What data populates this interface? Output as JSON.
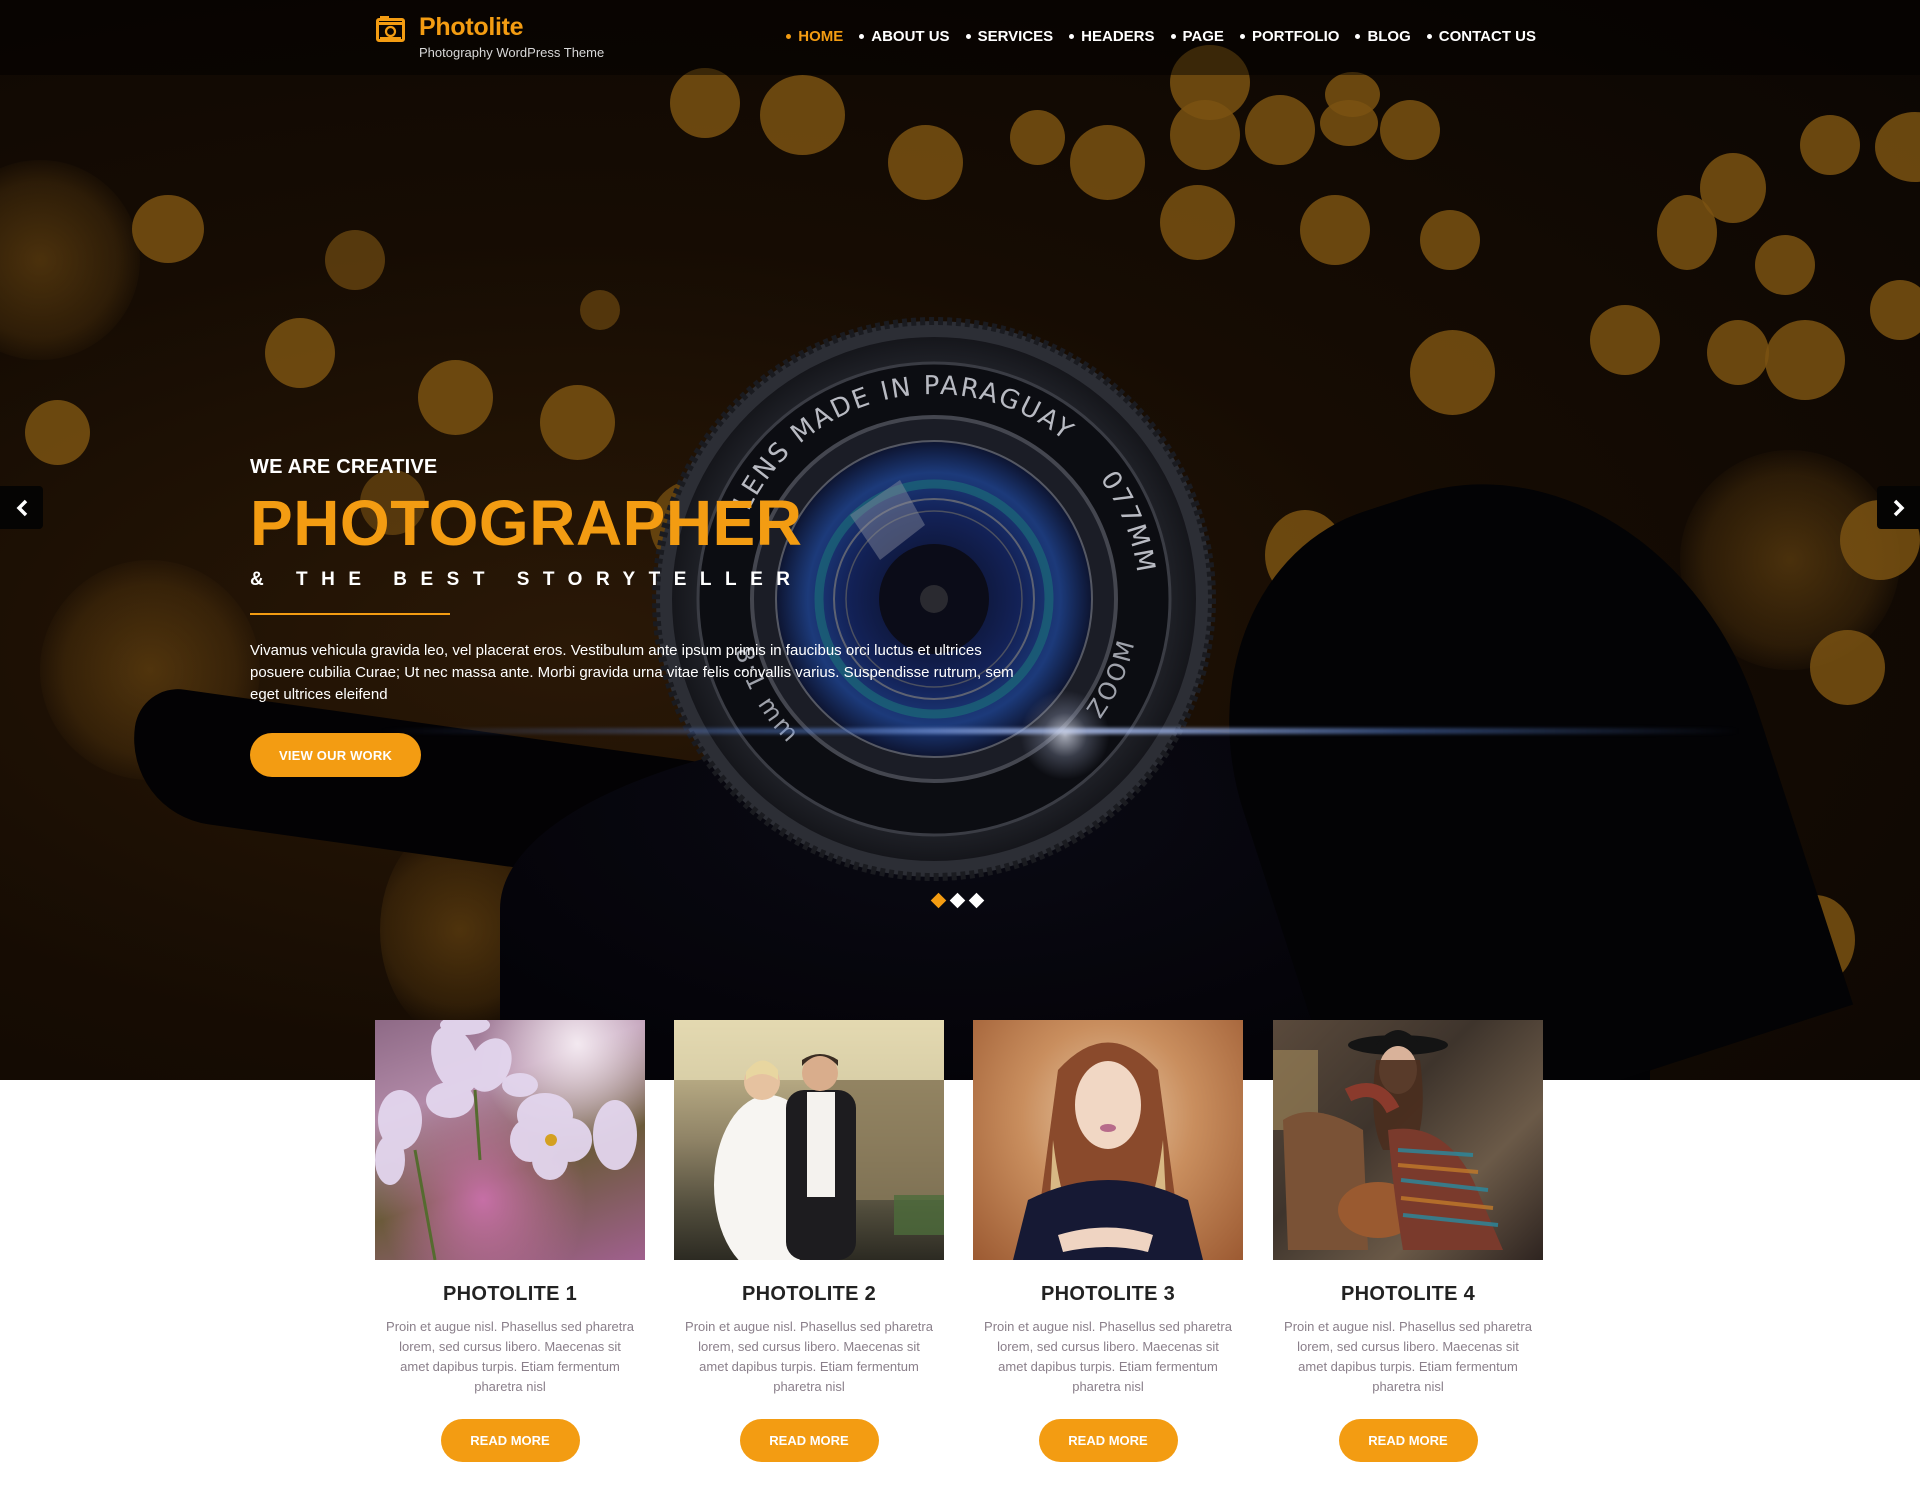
{
  "brand": {
    "title": "Photolite",
    "tagline": "Photography WordPress Theme",
    "accent_color": "#f39c12"
  },
  "nav": {
    "items": [
      {
        "label": "HOME",
        "active": true
      },
      {
        "label": "ABOUT US",
        "active": false
      },
      {
        "label": "SERVICES",
        "active": false
      },
      {
        "label": "HEADERS",
        "active": false
      },
      {
        "label": "PAGE",
        "active": false
      },
      {
        "label": "PORTFOLIO",
        "active": false
      },
      {
        "label": "BLOG",
        "active": false
      },
      {
        "label": "CONTACT US",
        "active": false
      }
    ]
  },
  "hero": {
    "kicker": "WE ARE CREATIVE",
    "headline": "PHOTOGRAPHER",
    "tagline": "& THE BEST STORYTELLER",
    "description": "Vivamus vehicula gravida leo, vel placerat eros. Vestibulum ante ipsum primis in faucibus orci luctus et ultrices posuere cubilia Curae; Ut nec massa ante. Morbi gravida urna vitae felis convallis varius. Suspendisse rutrum, sem eget ultrices eleifend",
    "cta_label": "VIEW OUR WORK",
    "lens_text_top": "LENS MADE IN PARAGUAY",
    "lens_text_right": "077MM",
    "lens_text_bottom_left": "8:1 mm",
    "lens_text_bottom_right": "ZOOM",
    "prev_icon": "chevron-left-icon",
    "next_icon": "chevron-right-icon",
    "slides_total": 3,
    "slide_active": 1
  },
  "cards": [
    {
      "title": "PHOTOLITE 1",
      "image": "purple-pansy-flowers",
      "description": "Proin et augue nisl. Phasellus sed pharetra lorem, sed cursus libero. Maecenas sit amet dapibus turpis. Etiam fermentum pharetra nisl",
      "button": "READ MORE"
    },
    {
      "title": "PHOTOLITE 2",
      "image": "wedding-couple",
      "description": "Proin et augue nisl. Phasellus sed pharetra lorem, sed cursus libero. Maecenas sit amet dapibus turpis. Etiam fermentum pharetra nisl",
      "button": "READ MORE"
    },
    {
      "title": "PHOTOLITE 3",
      "image": "woman-portrait-long-hair",
      "description": "Proin et augue nisl. Phasellus sed pharetra lorem, sed cursus libero. Maecenas sit amet dapibus turpis. Etiam fermentum pharetra nisl",
      "button": "READ MORE"
    },
    {
      "title": "PHOTOLITE 4",
      "image": "woman-in-hat-striped-dress",
      "description": "Proin et augue nisl. Phasellus sed pharetra lorem, sed cursus libero. Maecenas sit amet dapibus turpis. Etiam fermentum pharetra nisl",
      "button": "READ MORE"
    }
  ]
}
